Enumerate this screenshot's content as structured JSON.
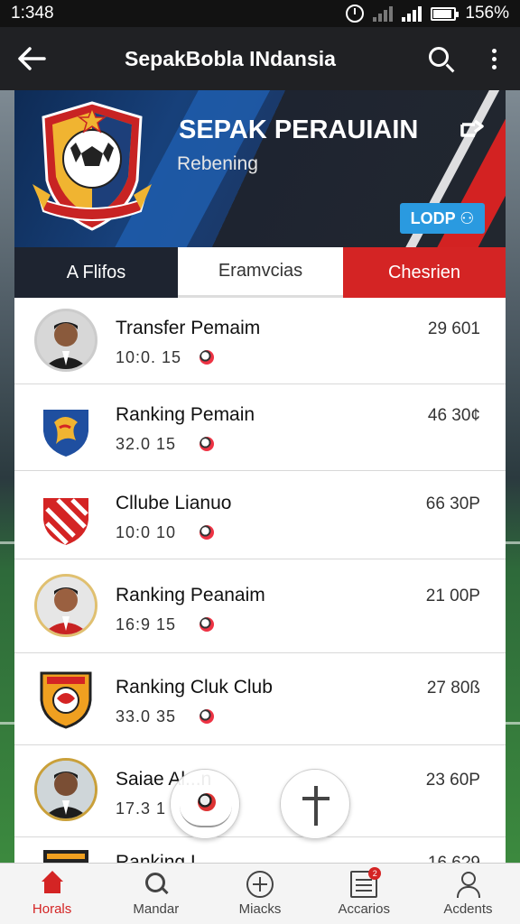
{
  "status_bar": {
    "time": "1:348",
    "battery": "156%"
  },
  "app_bar": {
    "title": "SepakBobla INdansia"
  },
  "banner": {
    "title": "SEPAK PERAUIAIN",
    "subtitle": "Rebening",
    "button_label": "LODP ⚇"
  },
  "tabs": [
    {
      "label": "A Flifos"
    },
    {
      "label": "Eramvcias"
    },
    {
      "label": "Chesrien"
    }
  ],
  "list": [
    {
      "title": "Transfer Pemaim",
      "sub": "10:0. 15",
      "value": "29 601",
      "thumb": "person"
    },
    {
      "title": "Ranking Pemain",
      "sub": "32.0  15",
      "value": "46 30¢",
      "thumb": "crest-blue"
    },
    {
      "title": "Cllube Lianuo",
      "sub": "10:0  10",
      "value": "66 30P",
      "thumb": "crest-red"
    },
    {
      "title": "Ranking Peanaim",
      "sub": "16:9  15",
      "value": "21 00P",
      "thumb": "person"
    },
    {
      "title": "Ranking Cluk Club",
      "sub": "33.0  35",
      "value": "27 80ß",
      "thumb": "crest-orange"
    },
    {
      "title": "Saiae Al...n",
      "sub": "17.3  1",
      "value": "23 60P",
      "thumb": "person"
    },
    {
      "title": "Ranking I",
      "sub": "",
      "value": "16 6?9",
      "thumb": "crest-dark"
    }
  ],
  "bottom_nav": [
    {
      "label": "Horals",
      "icon": "home-icon",
      "active": true
    },
    {
      "label": "Mandar",
      "icon": "search-icon"
    },
    {
      "label": "Miacks",
      "icon": "plus-circle-icon"
    },
    {
      "label": "Accarios",
      "icon": "document-icon",
      "badge": "2"
    },
    {
      "label": "Acdents",
      "icon": "person-icon"
    }
  ],
  "colors": {
    "accent": "#d42424",
    "banner_blue": "#17407a",
    "button_blue": "#2a9ae0"
  }
}
